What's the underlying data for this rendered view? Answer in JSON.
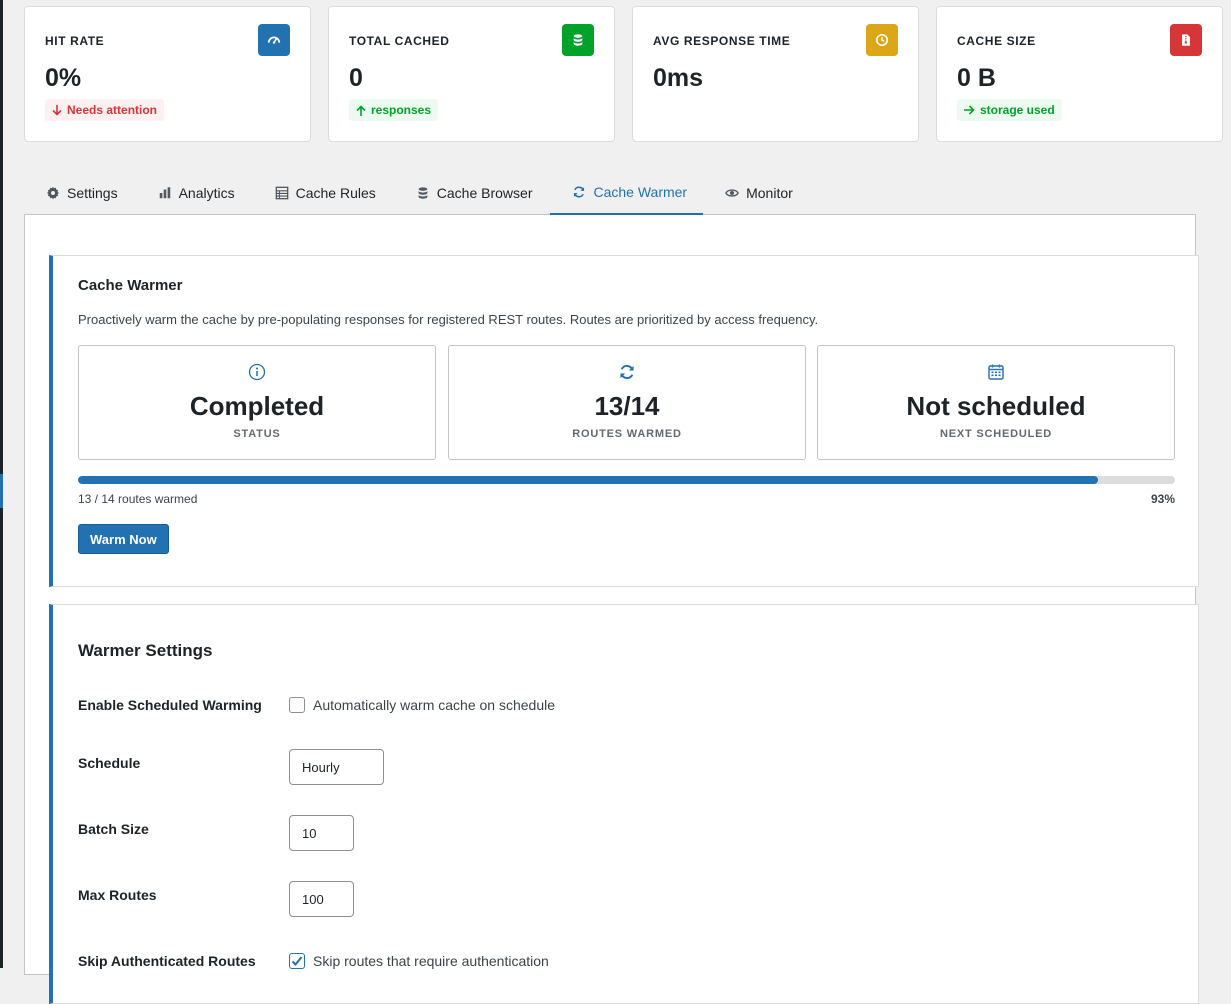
{
  "stats": [
    {
      "label": "HIT RATE",
      "value": "0%",
      "badge": "Needs attention",
      "badge_type": "red",
      "icon": "dashboard-icon",
      "icon_color": "#2271b1"
    },
    {
      "label": "TOTAL CACHED",
      "value": "0",
      "badge": "responses",
      "badge_type": "green",
      "icon": "database-icon",
      "icon_color": "#00a32a"
    },
    {
      "label": "AVG RESPONSE TIME",
      "value": "0ms",
      "badge": "",
      "badge_type": "",
      "icon": "clock-icon",
      "icon_color": "#dba617"
    },
    {
      "label": "CACHE SIZE",
      "value": "0 B",
      "badge": "storage used",
      "badge_type": "green",
      "icon": "file-icon",
      "icon_color": "#d63638"
    }
  ],
  "tabs": [
    {
      "label": "Settings",
      "icon": "gear-icon",
      "active": false
    },
    {
      "label": "Analytics",
      "icon": "bar-chart-icon",
      "active": false
    },
    {
      "label": "Cache Rules",
      "icon": "list-icon",
      "active": false
    },
    {
      "label": "Cache Browser",
      "icon": "database-icon",
      "active": false
    },
    {
      "label": "Cache Warmer",
      "icon": "refresh-icon",
      "active": true
    },
    {
      "label": "Monitor",
      "icon": "eye-icon",
      "active": false
    }
  ],
  "warmer": {
    "title": "Cache Warmer",
    "description": "Proactively warm the cache by pre-populating responses for registered REST routes. Routes are prioritized by access frequency.",
    "metrics": [
      {
        "value": "Completed",
        "label": "STATUS",
        "icon": "info-icon"
      },
      {
        "value": "13/14",
        "label": "ROUTES WARMED",
        "icon": "refresh-icon"
      },
      {
        "value": "Not scheduled",
        "label": "NEXT SCHEDULED",
        "icon": "calendar-icon"
      }
    ],
    "progress_fraction": 0.93,
    "progress_text": "13 / 14 routes warmed",
    "progress_percent": "93%",
    "warm_button": "Warm Now"
  },
  "settings": {
    "title": "Warmer Settings",
    "enable_label": "Enable Scheduled Warming",
    "enable_text": "Automatically warm cache on schedule",
    "enable_checked": false,
    "schedule_label": "Schedule",
    "schedule_value": "Hourly",
    "batch_label": "Batch Size",
    "batch_value": "10",
    "max_label": "Max Routes",
    "max_value": "100",
    "skip_label": "Skip Authenticated Routes",
    "skip_text": "Skip routes that require authentication",
    "skip_checked": true
  },
  "colors": {
    "accent": "#2271b1",
    "green": "#00a32a",
    "amber": "#dba617",
    "red": "#d63638"
  }
}
